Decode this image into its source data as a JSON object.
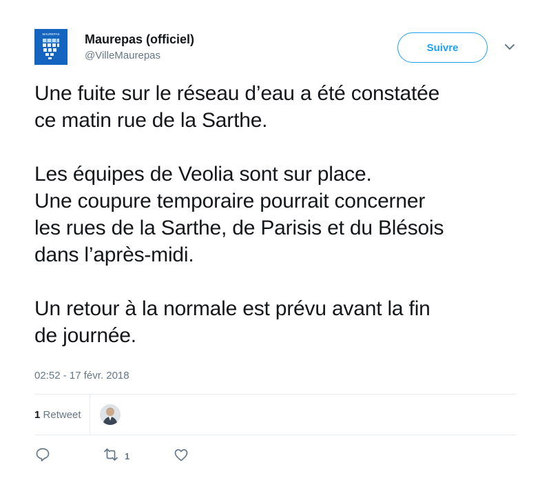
{
  "author": {
    "display_name": "Maurepas (officiel)",
    "handle": "@VilleMaurepas",
    "logo_text": "MAUREPAS"
  },
  "follow_button": {
    "label": "Suivre"
  },
  "tweet": {
    "paragraphs": [
      [
        "Une fuite sur le réseau d’eau a été constatée",
        "ce matin rue de la Sarthe."
      ],
      [
        "Les équipes de Veolia sont sur place.",
        "Une coupure temporaire pourrait concerner",
        "les rues de la Sarthe, de Parisis et du Blésois",
        "dans l’après-midi."
      ],
      [
        "Un retour à la normale est prévu avant la fin",
        "de journée."
      ]
    ],
    "timestamp": "02:52 - 17 févr. 2018"
  },
  "stats": {
    "retweet_count": "1",
    "retweet_label": "Retweet"
  },
  "actions": {
    "retweet_count": "1"
  },
  "colors": {
    "accent": "#1da1f2",
    "logo_blue": "#1565c0",
    "muted": "#657786",
    "divider": "#e6ecf0"
  },
  "icons": [
    "dropdown-caret-icon",
    "reply-icon",
    "retweet-icon",
    "like-icon"
  ]
}
